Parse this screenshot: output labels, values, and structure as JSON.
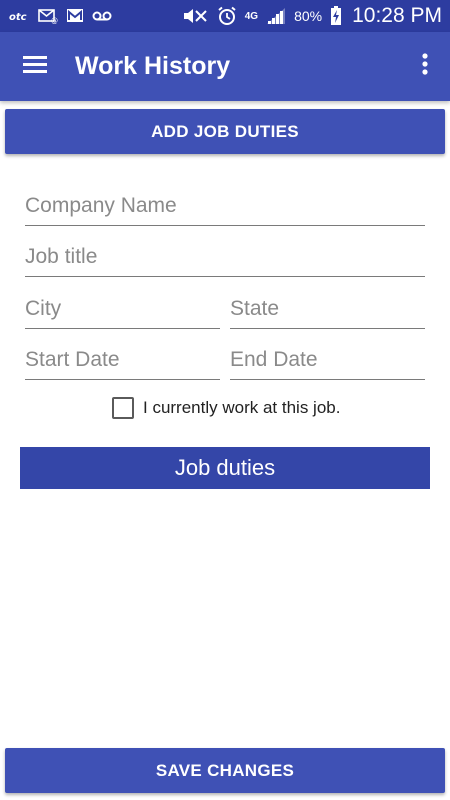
{
  "status_bar": {
    "left_icons": [
      "otc-icon",
      "mail-icon",
      "gmail-icon",
      "voicemail-icon"
    ],
    "network_label": "4G",
    "battery_percent": "80%",
    "time": "10:28 PM"
  },
  "app_bar": {
    "title": "Work History"
  },
  "actions": {
    "add_job_duties": "ADD JOB DUTIES",
    "job_duties": "Job duties",
    "save_changes": "SAVE CHANGES"
  },
  "form": {
    "company_name": {
      "placeholder": "Company Name",
      "value": ""
    },
    "job_title": {
      "placeholder": "Job title",
      "value": ""
    },
    "city": {
      "placeholder": "City",
      "value": ""
    },
    "state": {
      "placeholder": "State",
      "value": ""
    },
    "start_date": {
      "placeholder": "Start Date",
      "value": ""
    },
    "end_date": {
      "placeholder": "End Date",
      "value": ""
    },
    "current_job": {
      "label": "I currently work at this job.",
      "checked": false
    }
  },
  "colors": {
    "status_bar": "#2d3ca0",
    "app_bar": "#3f51b5",
    "button": "#3f51b5",
    "job_duties_button": "#3446a8"
  }
}
